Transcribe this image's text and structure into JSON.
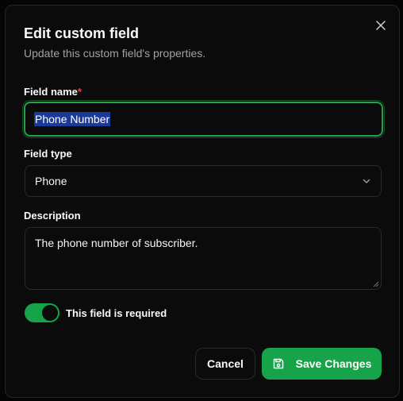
{
  "dialog": {
    "title": "Edit custom field",
    "subtitle": "Update this custom field's properties."
  },
  "fields": {
    "name_label": "Field name",
    "name_required_mark": "*",
    "name_value": "Phone Number",
    "type_label": "Field type",
    "type_value": "Phone",
    "description_label": "Description",
    "description_value": "The phone number of subscriber."
  },
  "required_toggle": {
    "label": "This field is required",
    "checked": true
  },
  "actions": {
    "cancel_label": "Cancel",
    "save_label": "Save Changes"
  },
  "colors": {
    "accent": "#16a34a",
    "focus_ring": "#22a24a",
    "required_mark": "#ef4444",
    "selection": "#1a3a9a"
  },
  "icons": {
    "close": "close-icon",
    "select_chevron": "chevron-down-icon",
    "save": "save-icon"
  }
}
